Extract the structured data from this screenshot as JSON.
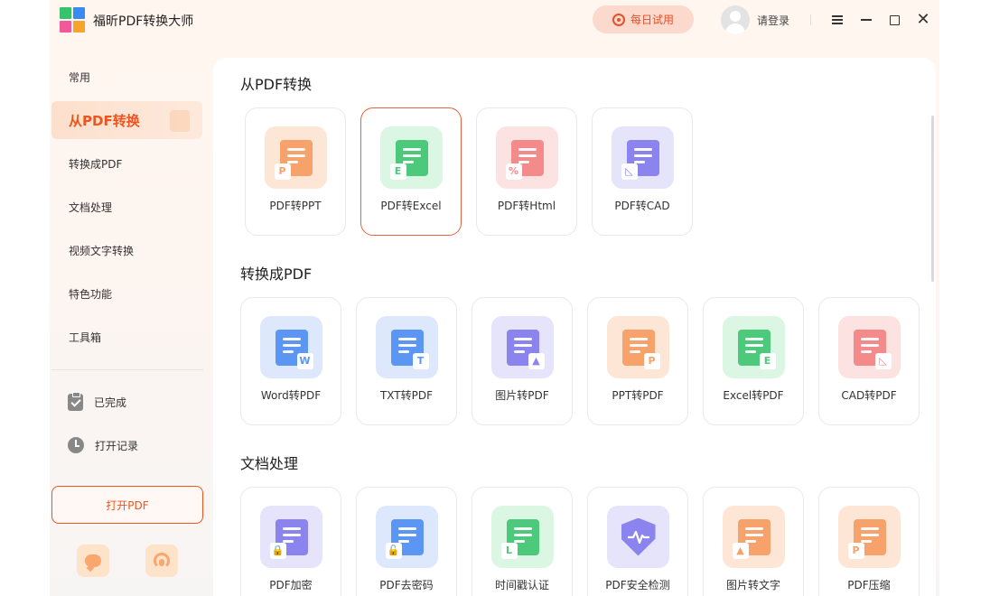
{
  "app": {
    "title": "福昕PDF转换大师",
    "trial_label": "每日试用",
    "login_label": "请登录",
    "accent_color": "#f0541e"
  },
  "sidebar": {
    "items": [
      {
        "label": "常用"
      },
      {
        "label": "从PDF转换"
      },
      {
        "label": "转换成PDF"
      },
      {
        "label": "文档处理"
      },
      {
        "label": "视频文字转换"
      },
      {
        "label": "特色功能"
      },
      {
        "label": "工具箱"
      }
    ],
    "active_index": 1,
    "links": [
      {
        "label": "已完成",
        "icon": "clipboard-check-icon"
      },
      {
        "label": "打开记录",
        "icon": "clock-icon"
      }
    ],
    "open_pdf_label": "打开PDF",
    "bottom_icons": [
      "feedback-chat-icon",
      "customer-service-icon"
    ]
  },
  "sections": [
    {
      "title": "从PDF转换",
      "cards": [
        {
          "label": "PDF转PPT",
          "icon": "pdf-to-ppt-icon",
          "color": "#f7a26b",
          "bg": "#fde6d6",
          "badge": "P"
        },
        {
          "label": "PDF转Excel",
          "icon": "pdf-to-excel-icon",
          "color": "#4cc97a",
          "bg": "#dcf6e4",
          "badge": "E",
          "selected": true
        },
        {
          "label": "PDF转Html",
          "icon": "pdf-to-html-icon",
          "color": "#f48a8a",
          "bg": "#fde2e2",
          "badge": "%"
        },
        {
          "label": "PDF转CAD",
          "icon": "pdf-to-cad-icon",
          "color": "#8c84ee",
          "bg": "#e6e4fb",
          "badge": "◺"
        }
      ]
    },
    {
      "title": "转换成PDF",
      "cards": [
        {
          "label": "Word转PDF",
          "icon": "word-to-pdf-icon",
          "color": "#5c96f5",
          "bg": "#dde8fd",
          "badge": "W"
        },
        {
          "label": "TXT转PDF",
          "icon": "txt-to-pdf-icon",
          "color": "#5c96f5",
          "bg": "#dde8fd",
          "badge": "T"
        },
        {
          "label": "图片转PDF",
          "icon": "image-to-pdf-icon",
          "color": "#8c84ee",
          "bg": "#e6e4fb",
          "badge": "▲"
        },
        {
          "label": "PPT转PDF",
          "icon": "ppt-to-pdf-icon",
          "color": "#f7a26b",
          "bg": "#fde6d6",
          "badge": "P"
        },
        {
          "label": "Excel转PDF",
          "icon": "excel-to-pdf-icon",
          "color": "#4cc97a",
          "bg": "#dcf6e4",
          "badge": "E"
        },
        {
          "label": "CAD转PDF",
          "icon": "cad-to-pdf-icon",
          "color": "#f48a8a",
          "bg": "#fde2e2",
          "badge": "◺"
        }
      ]
    },
    {
      "title": "文档处理",
      "cards": [
        {
          "label": "PDF加密",
          "icon": "pdf-encrypt-icon",
          "color": "#8c84ee",
          "bg": "#e6e4fb",
          "badge": "🔒"
        },
        {
          "label": "PDF去密码",
          "icon": "pdf-remove-password-icon",
          "color": "#5c96f5",
          "bg": "#dde8fd",
          "badge": "🔓"
        },
        {
          "label": "时间戳认证",
          "icon": "timestamp-icon",
          "color": "#4cc97a",
          "bg": "#dcf6e4",
          "badge": "L"
        },
        {
          "label": "PDF安全检测",
          "icon": "pdf-security-check-icon",
          "color": "#8c84ee",
          "bg": "#e6e4fb",
          "badge": ""
        },
        {
          "label": "图片转文字",
          "icon": "image-to-text-icon",
          "color": "#f7a26b",
          "bg": "#fde6d6",
          "badge": "▲"
        },
        {
          "label": "PDF压缩",
          "icon": "pdf-compress-icon",
          "color": "#f7a26b",
          "bg": "#fde6d6",
          "badge": "P"
        }
      ]
    }
  ]
}
